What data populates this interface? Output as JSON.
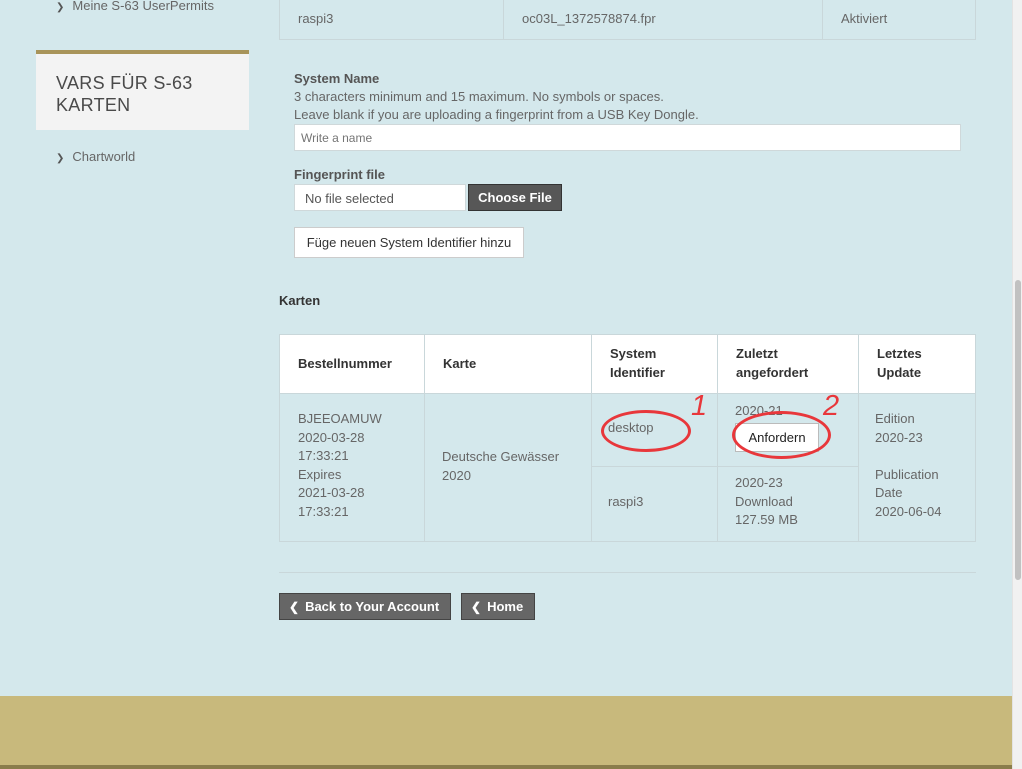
{
  "sidebar": {
    "top_link": "Meine S-63 UserPermits",
    "section_title": "VARS FÜR S-63 KARTEN",
    "link": "Chartworld"
  },
  "top_row": {
    "system": "raspi3",
    "file": "oc03L_1372578874.fpr",
    "status": "Aktiviert"
  },
  "form": {
    "system_name_label": "System Name",
    "help_line1": "3 characters minimum and 15 maximum. No symbols or spaces.",
    "help_line2": "Leave blank if you are uploading a fingerprint from a USB Key Dongle.",
    "system_name_placeholder": "Write a name",
    "fingerprint_label": "Fingerprint file",
    "file_status": "No file selected",
    "choose_file_label": "Choose File",
    "add_button_label": "Füge neuen System Identifier hinzu"
  },
  "karten": {
    "title": "Karten",
    "headers": {
      "order": "Bestellnummer",
      "chart": "Karte",
      "system_line1": "System",
      "system_line2": "Identifier",
      "requested_line1": "Zuletzt",
      "requested_line2": "angefordert",
      "update_line1": "Letztes",
      "update_line2": "Update"
    },
    "row": {
      "order_lines": [
        "BJEEOAMUW",
        "2020-03-28",
        "17:33:21",
        "Expires",
        "2021-03-28",
        "17:33:21"
      ],
      "chart_lines": [
        "Deutsche Gewässer",
        "2020"
      ],
      "systems": [
        {
          "name": "desktop",
          "requested": "2020-21",
          "action": "Anfordern"
        },
        {
          "name": "raspi3",
          "requested_lines": [
            "2020-23",
            "Download",
            "127.59 MB"
          ]
        }
      ],
      "update_lines": [
        "Edition",
        "2020-23",
        "",
        "Publication",
        "Date",
        "2020-06-04"
      ]
    }
  },
  "nav": {
    "back_label": "Back to Your Account",
    "home_label": "Home"
  },
  "annotations": {
    "one": "1",
    "two": "2",
    "color": "#e8373b"
  }
}
